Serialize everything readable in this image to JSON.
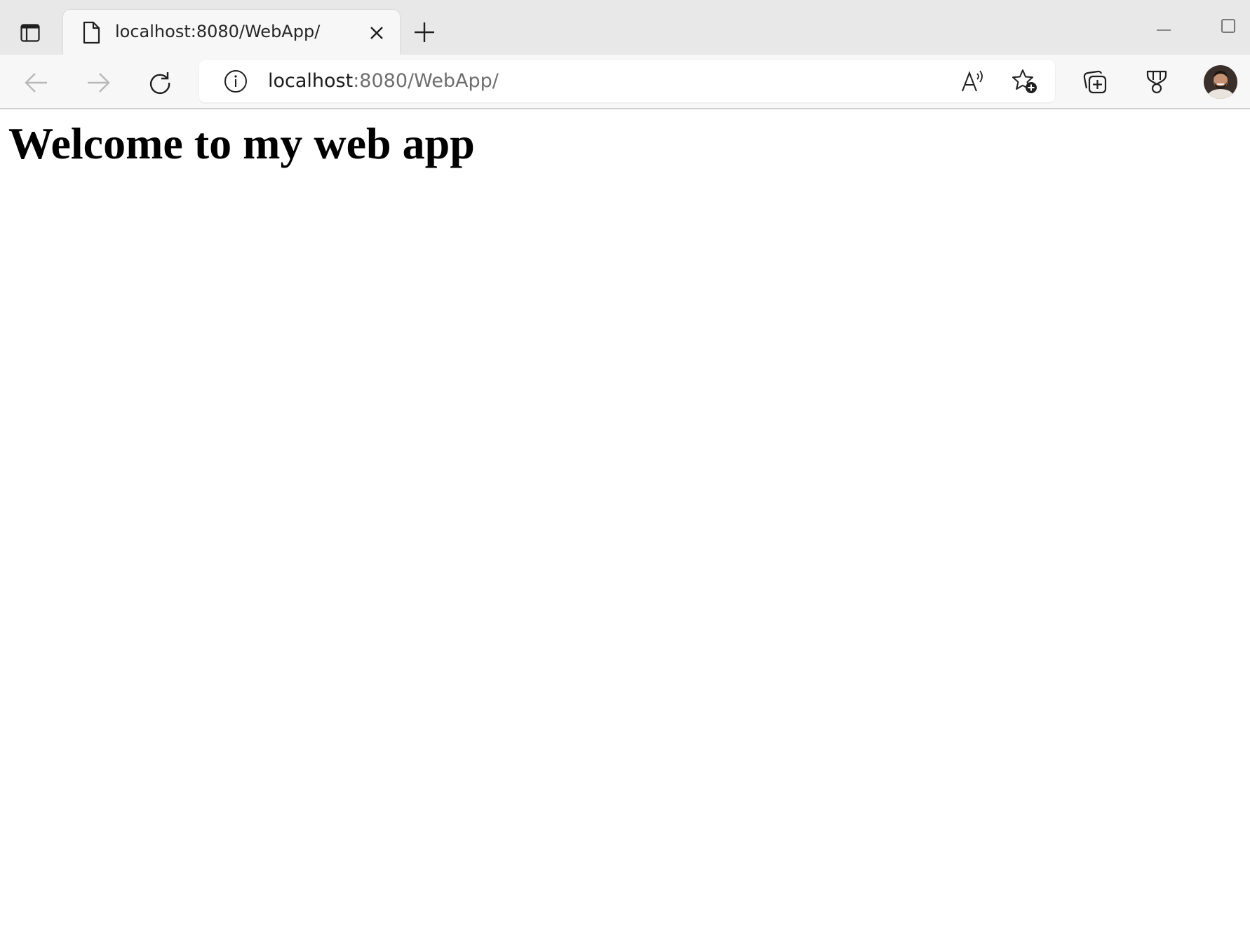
{
  "browser": {
    "tab": {
      "title": "localhost:8080/WebApp/"
    },
    "address": {
      "host": "localhost",
      "rest": ":8080/WebApp/"
    },
    "icons": {
      "tab_actions": "tab-actions-icon",
      "page": "page-icon",
      "close": "close-icon",
      "new_tab": "plus-icon",
      "back": "back-arrow-icon",
      "forward": "forward-arrow-icon",
      "refresh": "refresh-icon",
      "site_info": "info-icon",
      "read_aloud": "read-aloud-icon",
      "add_favorite": "star-add-icon",
      "collections": "collections-icon",
      "rewards": "trophy-icon",
      "minimize": "minimize-icon",
      "maximize": "maximize-icon"
    },
    "colors": {
      "tabbar_bg": "#e8e8e8",
      "toolbar_bg": "#f7f7f7",
      "disabled_icon": "#b8b8b8",
      "icon": "#1f1f1f"
    }
  },
  "page": {
    "heading": "Welcome to my web app"
  }
}
